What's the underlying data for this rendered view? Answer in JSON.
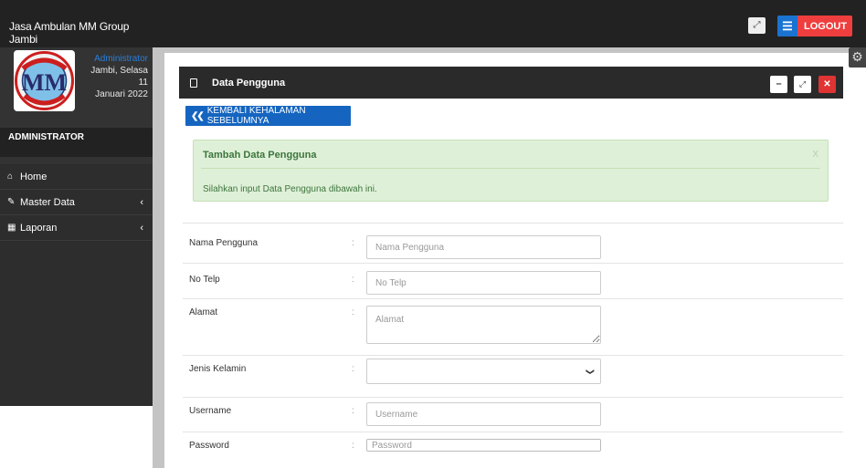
{
  "app": {
    "brand": "Jasa Ambulan MM Group Jambi"
  },
  "header": {
    "expand_icon": "expand-icon",
    "logout_label": "LOGOUT",
    "colors": {
      "topbar": "#222222",
      "logout": "#ef3e3e",
      "menu": "#1a73d1"
    }
  },
  "profile": {
    "role": "Administrator",
    "date_line1": "Jambi, Selasa 11",
    "date_line2": "Januari 2022",
    "logo_text": "AMBULANCE SERVICE",
    "logo_letters": "MM",
    "logo_city": "JAMBI"
  },
  "sidebar": {
    "section": "ADMINISTRATOR",
    "items": [
      {
        "icon": "home-icon",
        "label": "Home"
      },
      {
        "icon": "edit-icon",
        "label": "Master Data",
        "has_submenu": true
      },
      {
        "icon": "calendar-icon",
        "label": "Laporan",
        "has_submenu": true
      }
    ]
  },
  "panel": {
    "title": "Data Pengguna",
    "back_button": "KEMBALI KEHALAMAN SEBELUMNYA"
  },
  "alert": {
    "title": "Tambah Data Pengguna",
    "message": "Silahkan input Data Pengguna dibawah ini.",
    "close": "X",
    "color": "#dff0d8"
  },
  "form": {
    "separator": ":",
    "fields": [
      {
        "label": "Nama Pengguna",
        "placeholder": "Nama Pengguna",
        "value": ""
      },
      {
        "label": "No Telp",
        "placeholder": "No Telp",
        "value": ""
      },
      {
        "label": "Alamat",
        "placeholder": "Alamat",
        "value": ""
      },
      {
        "label": "Jenis Kelamin",
        "selected": ""
      },
      {
        "label": "Username",
        "placeholder": "Username",
        "value": ""
      },
      {
        "label": "Password",
        "placeholder": "Password",
        "value": ""
      }
    ]
  }
}
